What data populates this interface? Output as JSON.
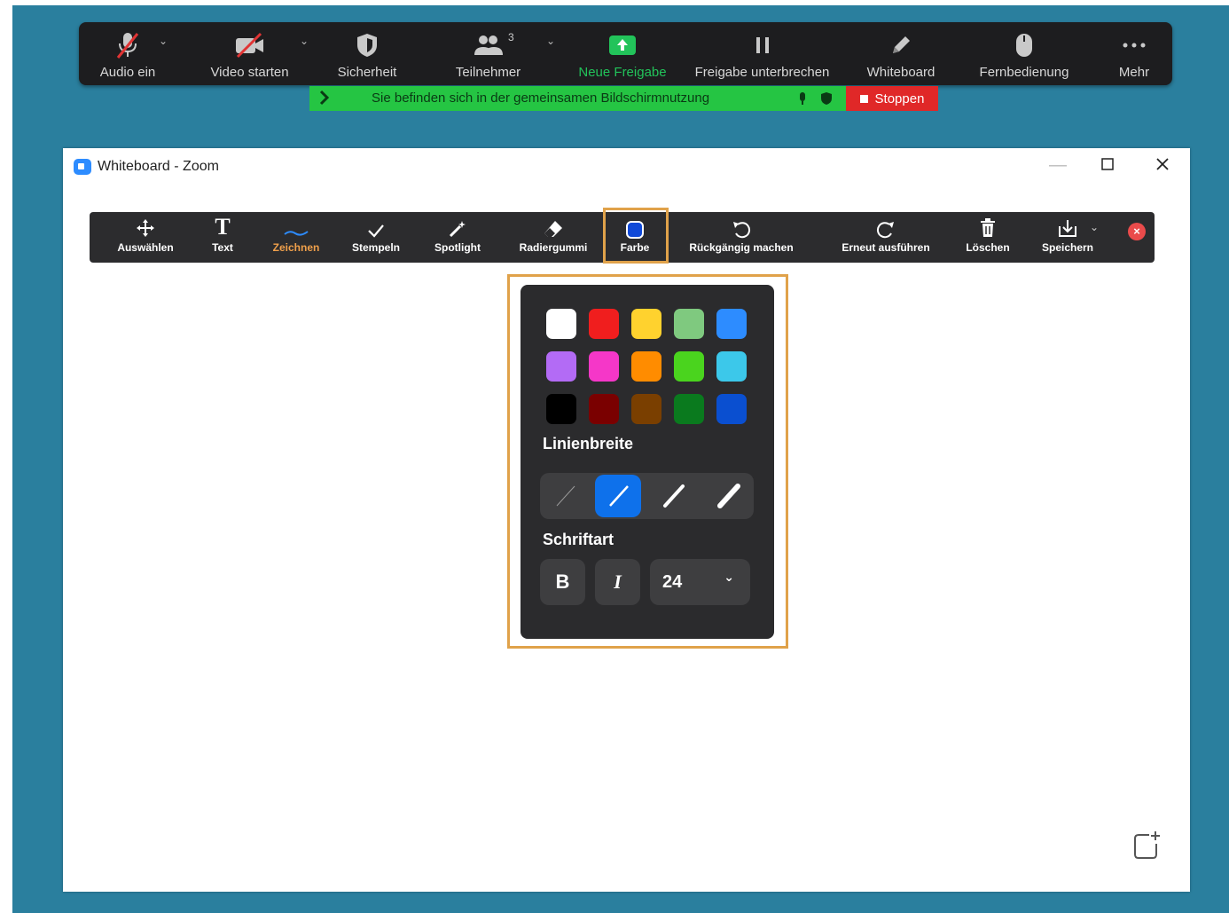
{
  "meeting_bar": {
    "audio": "Audio ein",
    "video": "Video starten",
    "security": "Sicherheit",
    "participants": "Teilnehmer",
    "participants_count": "3",
    "new_share": "Neue Freigabe",
    "pause_share": "Freigabe unterbrechen",
    "whiteboard": "Whiteboard",
    "remote": "Fernbedienung",
    "more": "Mehr"
  },
  "share_banner": {
    "text": "Sie befinden sich in der gemeinsamen Bildschirmnutzung",
    "stop": "Stoppen"
  },
  "window": {
    "title": "Whiteboard - Zoom"
  },
  "wb_toolbar": {
    "select": "Auswählen",
    "text": "Text",
    "draw": "Zeichnen",
    "stamp": "Stempeln",
    "spotlight": "Spotlight",
    "eraser": "Radiergummi",
    "color": "Farbe",
    "undo": "Rückgängig machen",
    "redo": "Erneut ausführen",
    "delete": "Löschen",
    "save": "Speichern"
  },
  "color_popup": {
    "colors": [
      "#ffffff",
      "#f01e1e",
      "#ffd22e",
      "#7fc97f",
      "#2d8cff",
      "#b36bf5",
      "#f537c8",
      "#ff8c00",
      "#4ad41e",
      "#3cc8ea",
      "#000000",
      "#7a0000",
      "#7a3f00",
      "#0a7a1e",
      "#0a4fd0"
    ],
    "selected_color": "#0a4fd0",
    "line_width_title": "Linienbreite",
    "selected_line_width": 2,
    "font_title": "Schriftart",
    "bold": "B",
    "italic": "I",
    "font_size": "24"
  }
}
